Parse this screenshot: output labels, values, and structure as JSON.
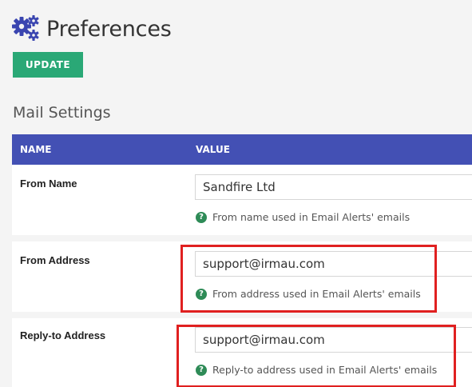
{
  "header": {
    "title": "Preferences",
    "icon": "gears-icon",
    "icon_color": "#3a45b0"
  },
  "toolbar": {
    "update_label": "UPDATE",
    "update_color": "#2aa876"
  },
  "section": {
    "title": "Mail Settings"
  },
  "table": {
    "head_color": "#4350b4",
    "columns": [
      "NAME",
      "VALUE"
    ],
    "rows": [
      {
        "name": "From Name",
        "value": "Sandfire Ltd",
        "hint": "From name used in Email Alerts' emails"
      },
      {
        "name": "From Address",
        "value": "support@irmau.com",
        "hint": "From address used in Email Alerts' emails"
      },
      {
        "name": "Reply-to Address",
        "value": "support@irmau.com",
        "hint": "Reply-to address used in Email Alerts' emails"
      }
    ]
  },
  "help_icon_glyph": "?",
  "highlight_color": "#e02020"
}
